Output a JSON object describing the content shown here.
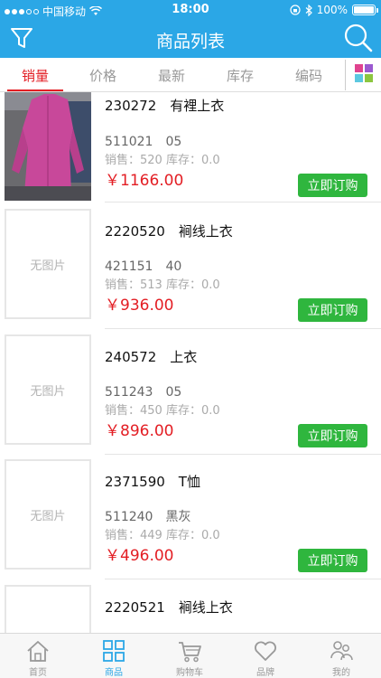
{
  "status_bar": {
    "carrier": "中国移动",
    "time": "18:00",
    "battery": "100%"
  },
  "nav": {
    "title": "商品列表"
  },
  "sort_tabs": [
    {
      "label": "销量",
      "active": true
    },
    {
      "label": "价格",
      "active": false
    },
    {
      "label": "最新",
      "active": false
    },
    {
      "label": "库存",
      "active": false
    },
    {
      "label": "编码",
      "active": false
    }
  ],
  "products": [
    {
      "name": "230272　有裡上衣",
      "code": "511021　05",
      "stats": "销售：520  库存：0.0",
      "price": "￥1166.00",
      "has_image": true,
      "no_image_text": "",
      "buy_label": "立即订购"
    },
    {
      "name": "2220520　裥线上衣",
      "code": "421151　40",
      "stats": "销售：513  库存：0.0",
      "price": "￥936.00",
      "has_image": false,
      "no_image_text": "无图片",
      "buy_label": "立即订购"
    },
    {
      "name": "240572　上衣",
      "code": "511243　05",
      "stats": "销售：450  库存：0.0",
      "price": "￥896.00",
      "has_image": false,
      "no_image_text": "无图片",
      "buy_label": "立即订购"
    },
    {
      "name": "2371590　T恤",
      "code": "511240　黑灰",
      "stats": "销售：449  库存：0.0",
      "price": "￥496.00",
      "has_image": false,
      "no_image_text": "无图片",
      "buy_label": "立即订购"
    },
    {
      "name": "2220521　裥线上衣",
      "code": "",
      "stats": "",
      "price": "",
      "has_image": false,
      "no_image_text": "",
      "buy_label": ""
    }
  ],
  "tab_bar": [
    {
      "label": "首页",
      "icon": "home-icon",
      "active": false
    },
    {
      "label": "商品",
      "icon": "grid-icon",
      "active": true
    },
    {
      "label": "购物车",
      "icon": "cart-icon",
      "active": false
    },
    {
      "label": "品牌",
      "icon": "heart-icon",
      "active": false
    },
    {
      "label": "我的",
      "icon": "user-icon",
      "active": false
    }
  ],
  "colors": {
    "primary": "#2ba7e6",
    "accent_red": "#e31e24",
    "buy_green": "#2fb63e"
  }
}
